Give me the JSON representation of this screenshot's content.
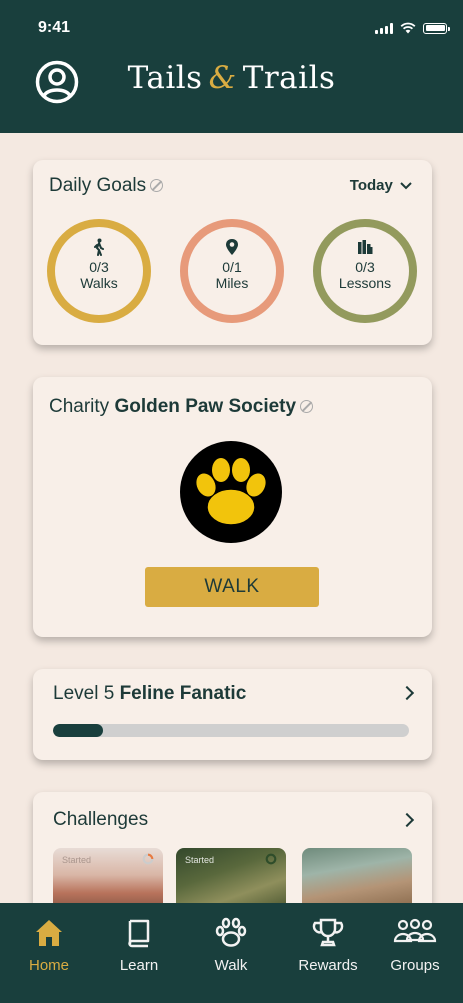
{
  "status": {
    "time": "9:41"
  },
  "header": {
    "title_part1": "Tails",
    "title_amp": "&",
    "title_part2": "Trails"
  },
  "goals": {
    "title": "Daily Goals",
    "period": "Today",
    "rings": [
      {
        "value": "0/3",
        "label": "Walks",
        "icon": "walking-person-icon",
        "color": "#d9ac42"
      },
      {
        "value": "0/1",
        "label": "Miles",
        "icon": "map-pin-icon",
        "color": "#e79a7a"
      },
      {
        "value": "0/3",
        "label": "Lessons",
        "icon": "books-icon",
        "color": "#939a5d"
      }
    ]
  },
  "charity": {
    "prefix": "Charity",
    "name": "Golden Paw Society",
    "button_label": "WALK",
    "logo_icon": "paw-print-icon"
  },
  "level": {
    "prefix": "Level 5",
    "name": "Feline Fanatic",
    "progress": 0.14
  },
  "challenges": {
    "title": "Challenges",
    "thumbs": [
      {
        "label": "Started"
      },
      {
        "label": "Started"
      },
      {
        "label": ""
      }
    ]
  },
  "tabs": [
    {
      "label": "Home",
      "icon": "home-icon",
      "active": true
    },
    {
      "label": "Learn",
      "icon": "book-icon",
      "active": false
    },
    {
      "label": "Walk",
      "icon": "paw-icon",
      "active": false
    },
    {
      "label": "Rewards",
      "icon": "trophy-icon",
      "active": false
    },
    {
      "label": "Groups",
      "icon": "people-group-icon",
      "active": false
    }
  ],
  "colors": {
    "header": "#193f3d",
    "accent": "#d9ac42",
    "background": "#f4e9e1"
  }
}
